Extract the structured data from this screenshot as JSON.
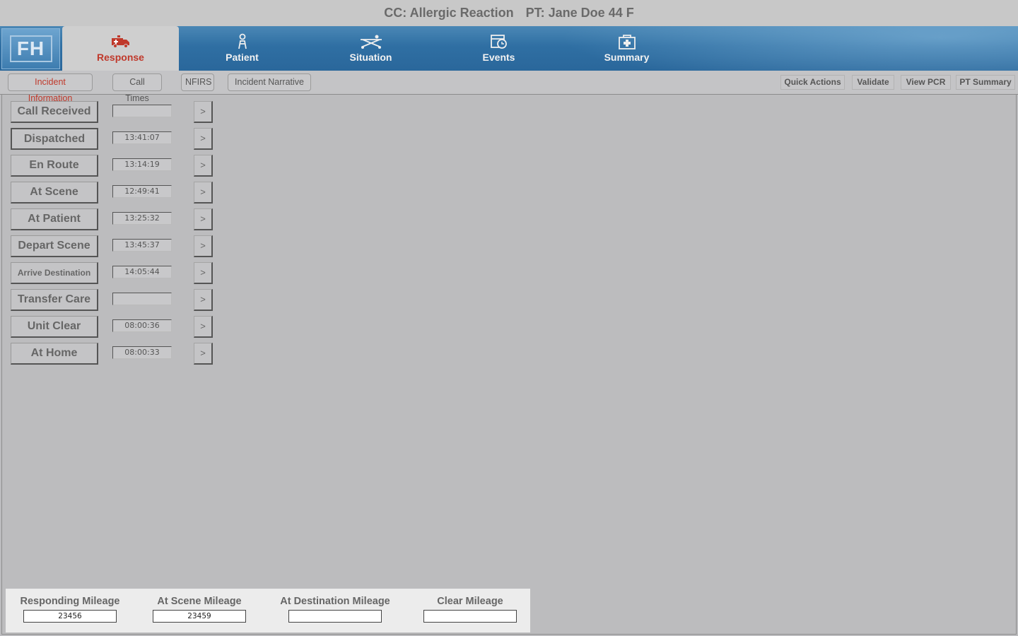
{
  "header": {
    "chief_complaint": "CC: Allergic Reaction",
    "patient": "PT: Jane Doe 44 F"
  },
  "logo": "FH",
  "nav_tabs": [
    {
      "label": "Response",
      "icon": "ambulance-icon",
      "active": true
    },
    {
      "label": "Patient",
      "icon": "person-icon",
      "active": false
    },
    {
      "label": "Situation",
      "icon": "stretcher-icon",
      "active": false
    },
    {
      "label": "Events",
      "icon": "clock-calendar-icon",
      "active": false
    },
    {
      "label": "Summary",
      "icon": "hospital-icon",
      "active": false
    }
  ],
  "sub_tabs": [
    {
      "label": "Incident Information",
      "active": true
    },
    {
      "label": "Call Times",
      "active": false
    },
    {
      "label": "NFIRS",
      "active": false
    },
    {
      "label": "Incident Narrative",
      "active": false
    }
  ],
  "actions": [
    "Quick Actions",
    "Validate",
    "View PCR",
    "PT Summary"
  ],
  "call_times": [
    {
      "label": "Call Received",
      "value": ""
    },
    {
      "label": "Dispatched",
      "value": "13:41:07"
    },
    {
      "label": "En Route",
      "value": "13:14:19"
    },
    {
      "label": "At Scene",
      "value": "12:49:41"
    },
    {
      "label": "At Patient",
      "value": "13:25:32"
    },
    {
      "label": "Depart Scene",
      "value": "13:45:37"
    },
    {
      "label": "Arrive Destination",
      "value": "14:05:44"
    },
    {
      "label": "Transfer Care",
      "value": ""
    },
    {
      "label": "Unit Clear",
      "value": "08:00:36"
    },
    {
      "label": "At Home",
      "value": "08:00:33"
    }
  ],
  "arrow_label": ">",
  "mileage": [
    {
      "label": "Responding Mileage",
      "value": "23456"
    },
    {
      "label": "At Scene Mileage",
      "value": "23459"
    },
    {
      "label": "At Destination Mileage",
      "value": ""
    },
    {
      "label": "Clear Mileage",
      "value": ""
    }
  ],
  "colors": {
    "accent_red": "#c0392b",
    "nav_blue": "#2f6fa3",
    "background": "#bcbcbe"
  }
}
